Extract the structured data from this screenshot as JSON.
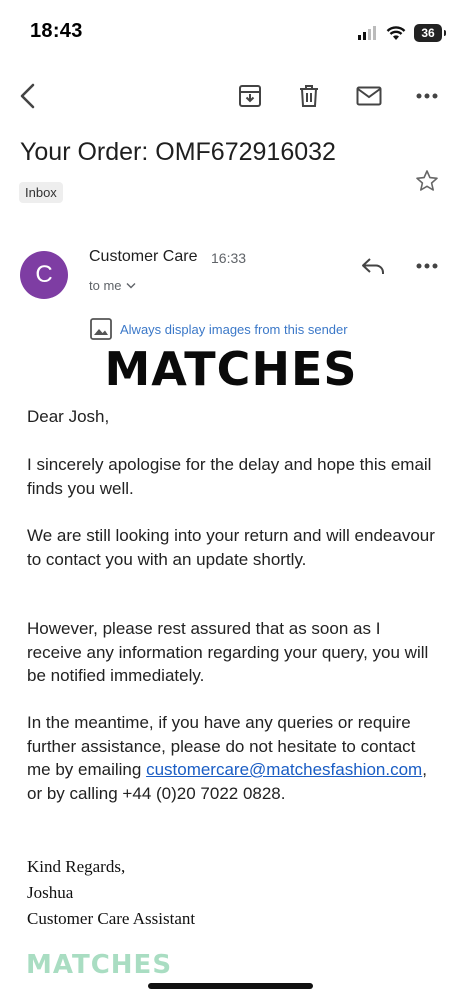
{
  "status_bar": {
    "time": "18:43",
    "battery": "36"
  },
  "email": {
    "subject": "Your Order: OMF672916032",
    "label": "Inbox",
    "sender": {
      "initial": "C",
      "name": "Customer Care",
      "time": "16:33",
      "recipient": "to me"
    },
    "images_notice": "Always display images from this sender",
    "brand": "MATCHES",
    "body": {
      "greeting": "Dear Josh,",
      "p1": "I sincerely apologise for the delay and hope this email finds you well.",
      "p2": "We are still looking into your return and will endeavour to contact you with an update shortly.",
      "p3": "However, please rest assured that as soon as I receive any information regarding your query, you will be notified immediately.",
      "p4_before": "In the meantime, if you have any queries or require further assistance, please do not hesitate to contact me by emailing",
      "p4_email": "customercare@matchesfashion.com",
      "p4_after": ",",
      "p4_phone": "or by calling +44 (0)20 7022 0828."
    },
    "signature": {
      "closing": "Kind Regards,",
      "name": "Joshua",
      "title": "Customer Care Assistant"
    },
    "footer_brand": "MATCHES"
  },
  "colors": {
    "avatar": "#7e3da3",
    "link": "#1a5dc4",
    "footer_logo": "#a9ddc2"
  },
  "icons": [
    "back-icon",
    "archive-icon",
    "delete-icon",
    "mail-icon",
    "more-icon",
    "star-icon",
    "reply-icon",
    "image-icon",
    "chevron-down-icon"
  ]
}
